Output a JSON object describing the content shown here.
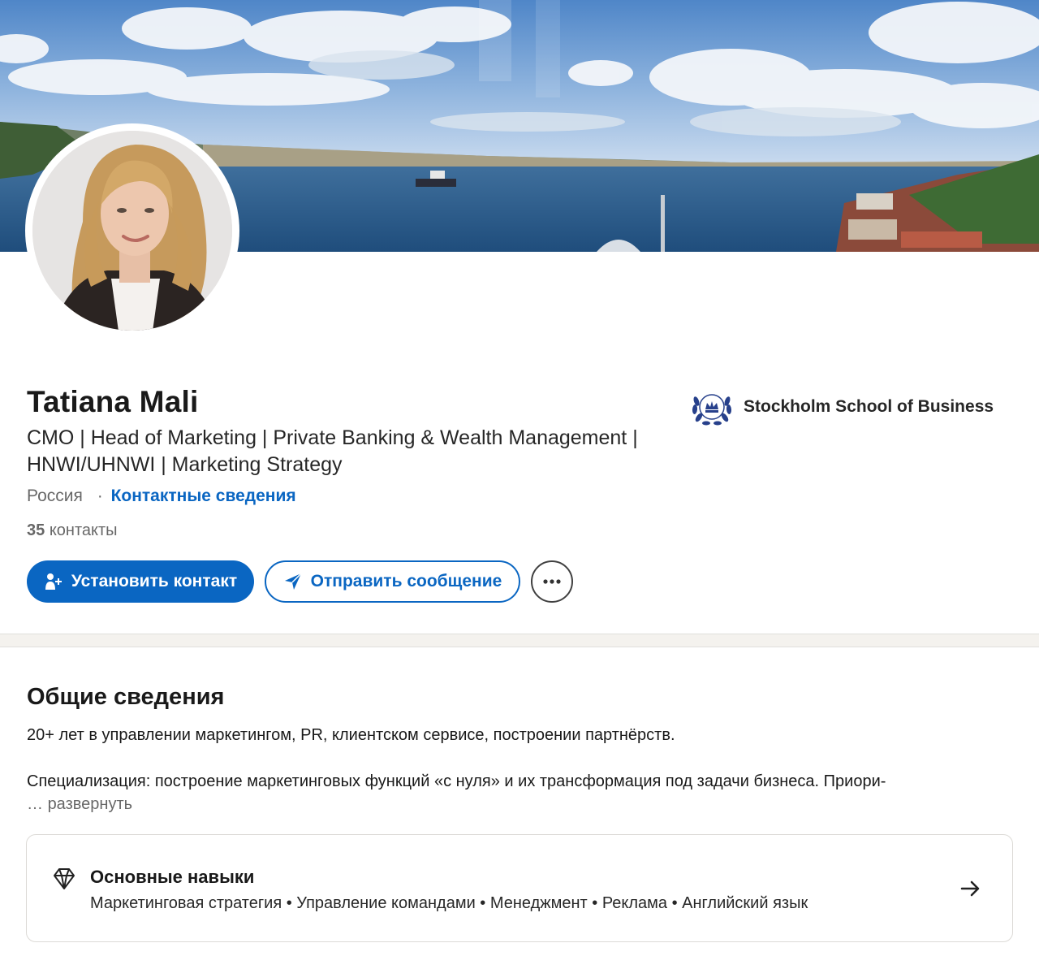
{
  "profile": {
    "name": "Tatiana Mali",
    "headline_line1": "CMO | Head of Marketing | Private Banking & Wealth Management |",
    "headline_line2": "HNWI/UHNWI | Marketing Strategy",
    "location": "Россия",
    "location_separator": "·",
    "contact_info_link": "Контактные сведения",
    "connections_count": "35",
    "connections_label": "контакты",
    "education": {
      "school": "Stockholm School of Business",
      "logo_icon": "laurel-crown-crest-icon"
    }
  },
  "actions": {
    "connect_label": "Установить контакт",
    "connect_icon": "add-person-icon",
    "message_label": "Отправить сообщение",
    "message_icon": "paper-plane-icon",
    "more_icon": "ellipsis-icon"
  },
  "about": {
    "title": "Общие сведения",
    "paragraph1": "20+ лет в управлении маркетингом, PR, клиентском сервисе, построении партнёрств.",
    "paragraph2": "Специализация: построение маркетинговых функций «с нуля» и их трансформация под задачи бизнеса. Приори-",
    "ellipsis": "…",
    "expand_label": "развернуть"
  },
  "top_skills": {
    "icon": "diamond-icon",
    "title": "Основные навыки",
    "list": "Маркетинговая стратегия • Управление командами • Менеджмент • Реклама • Английский язык",
    "arrow_icon": "arrow-right-icon"
  },
  "colors": {
    "brand_blue": "#0a66c2",
    "page_background": "#f4f2ee",
    "card_background": "#ffffff"
  }
}
